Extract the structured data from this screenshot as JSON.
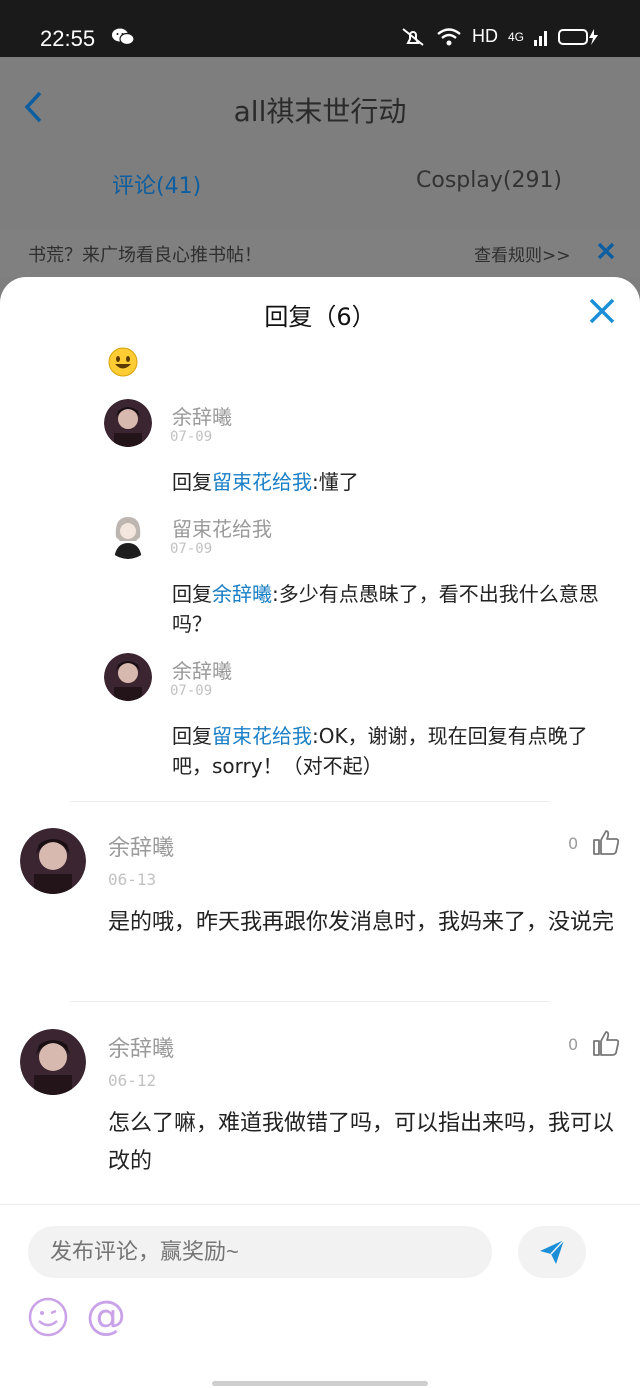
{
  "status_bar": {
    "time": "22:55",
    "hd": "HD",
    "network": "4G"
  },
  "header": {
    "title": "all祺末世行动"
  },
  "tabs": [
    {
      "label": "评论(41)"
    },
    {
      "label": "Cosplay(291)"
    }
  ],
  "notice": {
    "text": "书荒？来广场看良心推书帖！",
    "rules": "查看规则>>"
  },
  "sheet": {
    "title": "回复（6）",
    "replies": [
      {
        "name": "余辞曦",
        "date": "07-09",
        "prefix": "回复",
        "target": "留束花给我",
        "text": ":懂了"
      },
      {
        "name": "留束花给我",
        "date": "07-09",
        "prefix": "回复",
        "target": "余辞曦",
        "text": ":多少有点愚昧了，看不出我什么意思吗？"
      },
      {
        "name": "余辞曦",
        "date": "07-09",
        "prefix": "回复",
        "target": "留束花给我",
        "text": ":OK，谢谢，现在回复有点晚了吧，sorry！（对不起）"
      }
    ],
    "comments": [
      {
        "name": "余辞曦",
        "date": "06-13",
        "likes": "0",
        "text": "是的哦，昨天我再跟你发消息时，我妈来了，没说完"
      },
      {
        "name": "余辞曦",
        "date": "06-12",
        "likes": "0",
        "text": "怎么了嘛，难道我做错了吗，可以指出来吗，我可以改的"
      }
    ]
  },
  "input": {
    "placeholder": "发布评论，赢奖励~"
  },
  "colors": {
    "accent": "#1a7fc6",
    "tab_active": "#0d5ea0",
    "at_icon": "#c9a2e8"
  }
}
